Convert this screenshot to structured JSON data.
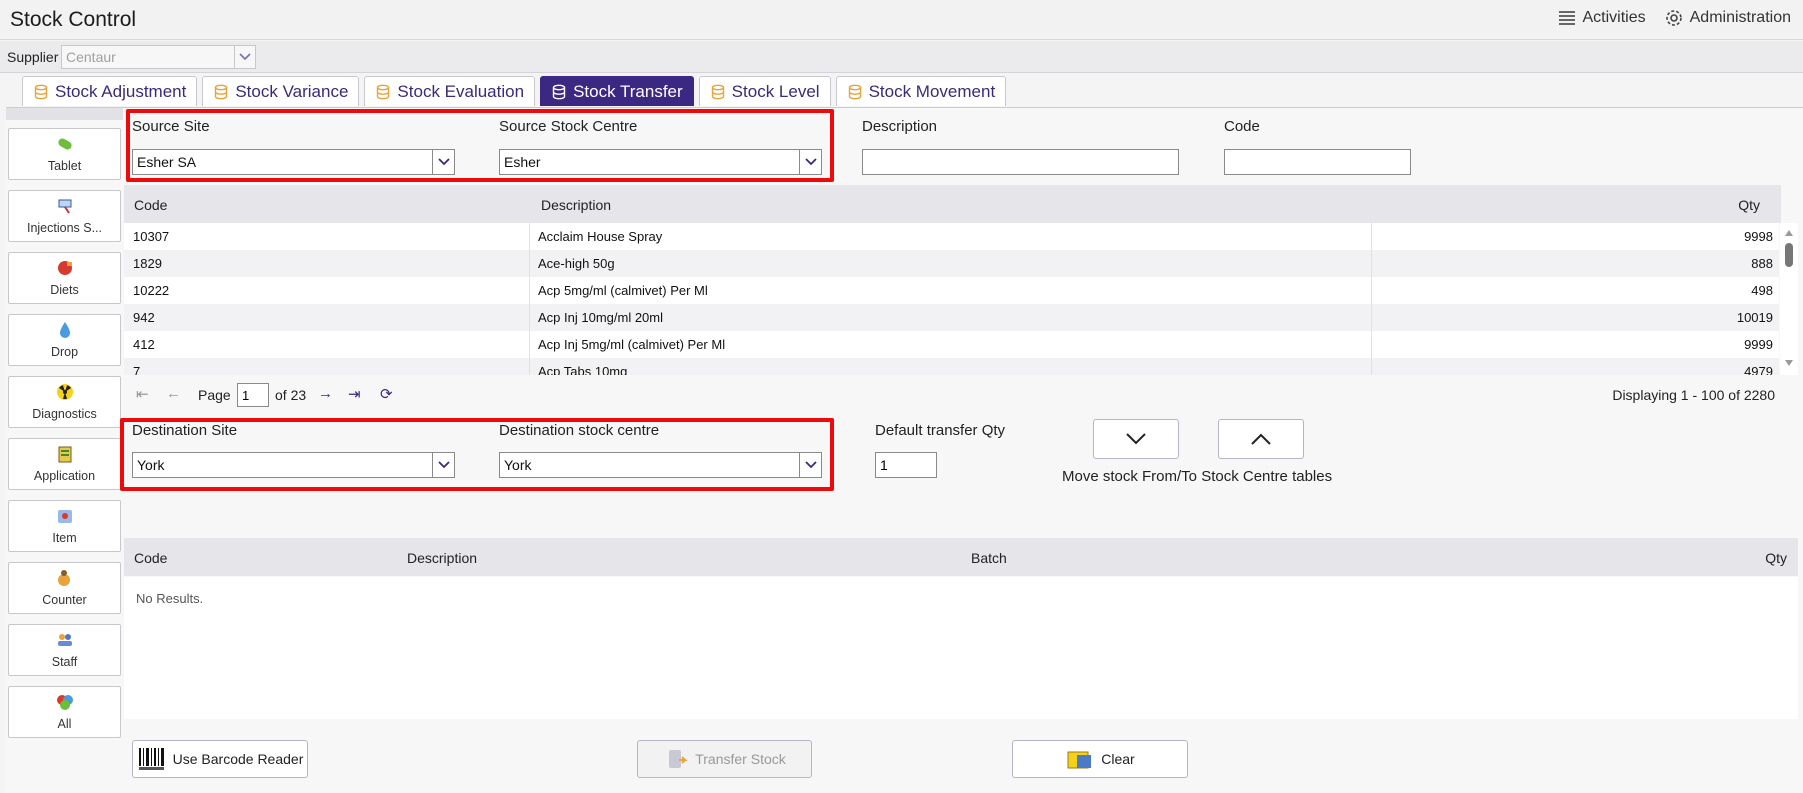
{
  "app": {
    "title": "Stock Control",
    "activities_label": "Activities",
    "administration_label": "Administration"
  },
  "supplier": {
    "label": "Supplier",
    "value": "Centaur"
  },
  "tabs": [
    {
      "label": "Stock Adjustment",
      "icon": "database-icon",
      "active": false
    },
    {
      "label": "Stock Variance",
      "icon": "database-icon",
      "active": false
    },
    {
      "label": "Stock Evaluation",
      "icon": "database-icon",
      "active": false
    },
    {
      "label": "Stock Transfer",
      "icon": "database-icon",
      "active": true
    },
    {
      "label": "Stock Level",
      "icon": "database-icon",
      "active": false
    },
    {
      "label": "Stock Movement",
      "icon": "database-icon",
      "active": false
    }
  ],
  "sidebar": {
    "items": [
      {
        "label": "Tablet",
        "icon": "pill-icon"
      },
      {
        "label": "Injections S...",
        "icon": "syringe-icon"
      },
      {
        "label": "Diets",
        "icon": "food-icon"
      },
      {
        "label": "Drop",
        "icon": "droplet-icon"
      },
      {
        "label": "Diagnostics",
        "icon": "radiation-icon"
      },
      {
        "label": "Application",
        "icon": "clipboard-icon"
      },
      {
        "label": "Item",
        "icon": "item-icon"
      },
      {
        "label": "Counter",
        "icon": "counter-icon"
      },
      {
        "label": "Staff",
        "icon": "staff-icon"
      },
      {
        "label": "All",
        "icon": "all-icon"
      }
    ]
  },
  "filters": {
    "source_site_label": "Source Site",
    "source_site_value": "Esher SA",
    "source_centre_label": "Source Stock Centre",
    "source_centre_value": "Esher",
    "description_label": "Description",
    "description_value": "",
    "code_label": "Code",
    "code_value": ""
  },
  "source_grid": {
    "headers": {
      "code": "Code",
      "description": "Description",
      "qty": "Qty"
    },
    "rows": [
      {
        "code": "10307",
        "description": "Acclaim House Spray",
        "qty": "9998"
      },
      {
        "code": "1829",
        "description": "Ace-high 50g",
        "qty": "888"
      },
      {
        "code": "10222",
        "description": "Acp 5mg/ml (calmivet) Per Ml",
        "qty": "498"
      },
      {
        "code": "942",
        "description": "Acp Inj 10mg/ml 20ml",
        "qty": "10019"
      },
      {
        "code": "412",
        "description": "Acp Inj 5mg/ml (calmivet) Per Ml",
        "qty": "9999"
      },
      {
        "code": "7",
        "description": "Acp Tabs 10mg",
        "qty": "4979"
      }
    ]
  },
  "pager": {
    "page_label": "Page",
    "page_value": "1",
    "of_label": "of 23",
    "display_text": "Displaying 1 - 100 of 2280"
  },
  "destination": {
    "site_label": "Destination Site",
    "site_value": "York",
    "centre_label": "Destination stock centre",
    "centre_value": "York",
    "default_qty_label": "Default transfer Qty",
    "default_qty_value": "1",
    "move_label": "Move stock From/To Stock Centre tables"
  },
  "dest_grid": {
    "headers": {
      "code": "Code",
      "description": "Description",
      "batch": "Batch",
      "qty": "Qty"
    },
    "empty_text": "No Results."
  },
  "actions": {
    "barcode_label": "Use Barcode Reader",
    "transfer_label": "Transfer Stock",
    "clear_label": "Clear"
  },
  "colors": {
    "accent": "#3a2883",
    "highlight": "#ee0a0a",
    "tab_icon": "#e8a33a"
  }
}
